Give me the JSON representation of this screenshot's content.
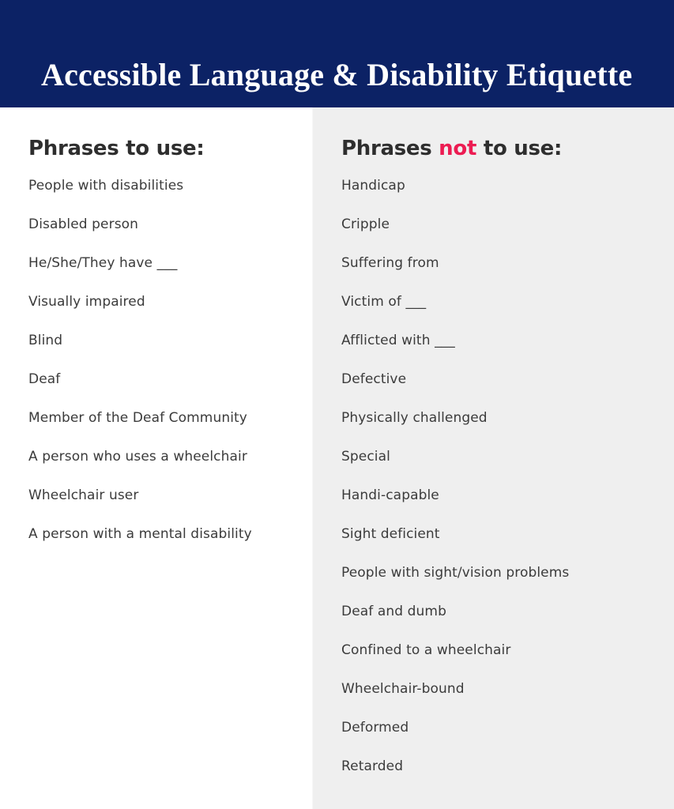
{
  "header": {
    "title": "Accessible Language & Disability Etiquette",
    "background_color": "#0c2265",
    "text_color": "#ffffff"
  },
  "columns": {
    "use": {
      "heading": "Phrases to use:",
      "background_color": "#ffffff",
      "items": [
        "People with disabilities",
        "Disabled person",
        "He/She/They have ___",
        "Visually impaired",
        "Blind",
        "Deaf",
        "Member of the Deaf Community",
        "A person who uses a wheelchair",
        "Wheelchair user",
        "A person with a mental disability"
      ]
    },
    "avoid": {
      "heading_before": "Phrases ",
      "heading_accent": "not",
      "heading_after": " to use:",
      "accent_color": "#ec1c52",
      "background_color": "#efefef",
      "items": [
        "Handicap",
        "Cripple",
        "Suffering from",
        "Victim of ___",
        "Afflicted with ___",
        "Defective",
        "Physically challenged",
        "Special",
        "Handi-capable",
        "Sight deficient",
        "People with sight/vision problems",
        "Deaf and dumb",
        "Confined to a wheelchair",
        "Wheelchair-bound",
        "Deformed",
        "Retarded"
      ]
    }
  },
  "body_text_color": "#3b3b3b"
}
